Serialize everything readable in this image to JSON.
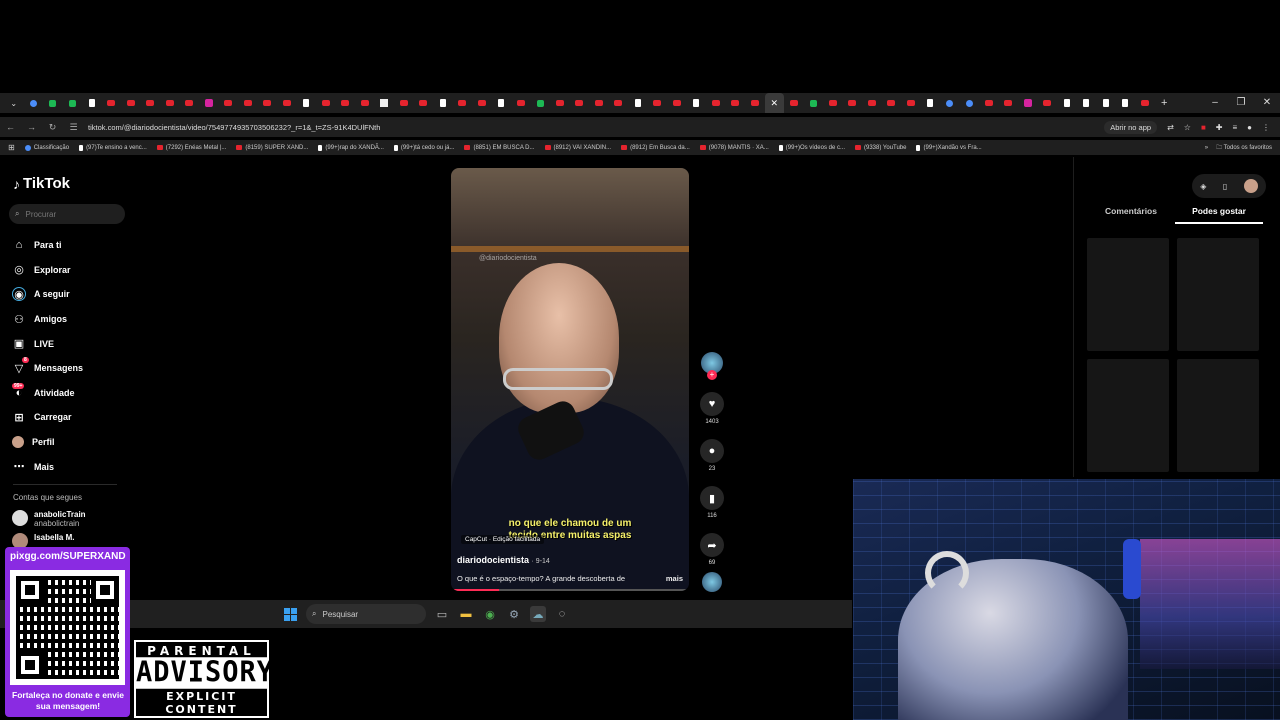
{
  "browser": {
    "url": "tiktok.com/@diariodocientista/video/7549774935703506232?_r=1&_t=ZS-91K4DUlFNth",
    "open_app_label": "Abrir no app",
    "all_bookmarks_label": "Todos os favoritos",
    "bookmarks": [
      {
        "icon": "globe-icon",
        "label": "Classificação"
      },
      {
        "icon": "tiktok-icon",
        "label": "(97)Te ensino a venc..."
      },
      {
        "icon": "youtube-icon",
        "label": "(7292) Enéas Metal |..."
      },
      {
        "icon": "youtube-icon",
        "label": "(8159) SUPER XAND..."
      },
      {
        "icon": "tiktok-icon",
        "label": "(99+)rap do XANDÃ..."
      },
      {
        "icon": "tiktok-icon",
        "label": "(99+)tá cedo ou já..."
      },
      {
        "icon": "youtube-icon",
        "label": "(8851) EM BUSCA D..."
      },
      {
        "icon": "youtube-icon",
        "label": "(8912) VAI XANDIN..."
      },
      {
        "icon": "youtube-icon",
        "label": "(8912) Em Busca da..."
      },
      {
        "icon": "youtube-icon",
        "label": "(9078) MANTIS · XA..."
      },
      {
        "icon": "tiktok-icon",
        "label": "(99+)Os vídeos de c..."
      },
      {
        "icon": "youtube-icon",
        "label": "(9338) YouTube"
      },
      {
        "icon": "tiktok-icon",
        "label": "(99+)Xandão vs Fra..."
      }
    ]
  },
  "tiktok": {
    "logo": "TikTok",
    "search_placeholder": "Procurar",
    "nav": [
      {
        "label": "Para ti",
        "icon": "home-icon"
      },
      {
        "label": "Explorar",
        "icon": "compass-icon"
      },
      {
        "label": "A seguir",
        "icon": "following-icon"
      },
      {
        "label": "Amigos",
        "icon": "friends-icon"
      },
      {
        "label": "LIVE",
        "icon": "live-icon"
      },
      {
        "label": "Mensagens",
        "icon": "messages-icon",
        "badge": "8"
      },
      {
        "label": "Atividade",
        "icon": "activity-icon",
        "badge": "99+"
      },
      {
        "label": "Carregar",
        "icon": "upload-icon"
      },
      {
        "label": "Perfil",
        "icon": "profile-icon"
      },
      {
        "label": "Mais",
        "icon": "more-icon"
      }
    ],
    "following_title": "Contas que segues",
    "following": [
      {
        "name": "anabolicTrain",
        "handle": "anabolictrain"
      },
      {
        "name": "Isabella M.",
        "handle": ""
      }
    ],
    "video": {
      "watermark": "@diariodocientista",
      "subtitle_line1": "no que ele chamou de um",
      "subtitle_line2": "tecido entre muitas aspas",
      "capcut_label": "CapCut · Edição facilitada",
      "author": "diariodocientista",
      "date": "· 9-14",
      "description": "O que é o espaço-tempo? A grande descoberta de",
      "more_label": "mais",
      "progress": 0.2
    },
    "actions": {
      "likes": "1403",
      "comments": "23",
      "saves": "116",
      "shares": "69"
    },
    "right_tabs": [
      "Comentários",
      "Podes gostar"
    ],
    "active_tab": "Podes gostar"
  },
  "taskbar": {
    "search_placeholder": "Pesquisar"
  },
  "overlay": {
    "donate_url": "pixgg.com/SUPERXAND",
    "donate_message": "Fortaleça no donate e envie sua mensagem!",
    "advisory_line1": "PARENTAL",
    "advisory_line2": "ADVISORY",
    "advisory_line3": "EXPLICIT CONTENT"
  },
  "colors": {
    "accent": "#fe2c55",
    "donate_bg": "#8a2be2",
    "subtitle": "#f5f06a"
  }
}
